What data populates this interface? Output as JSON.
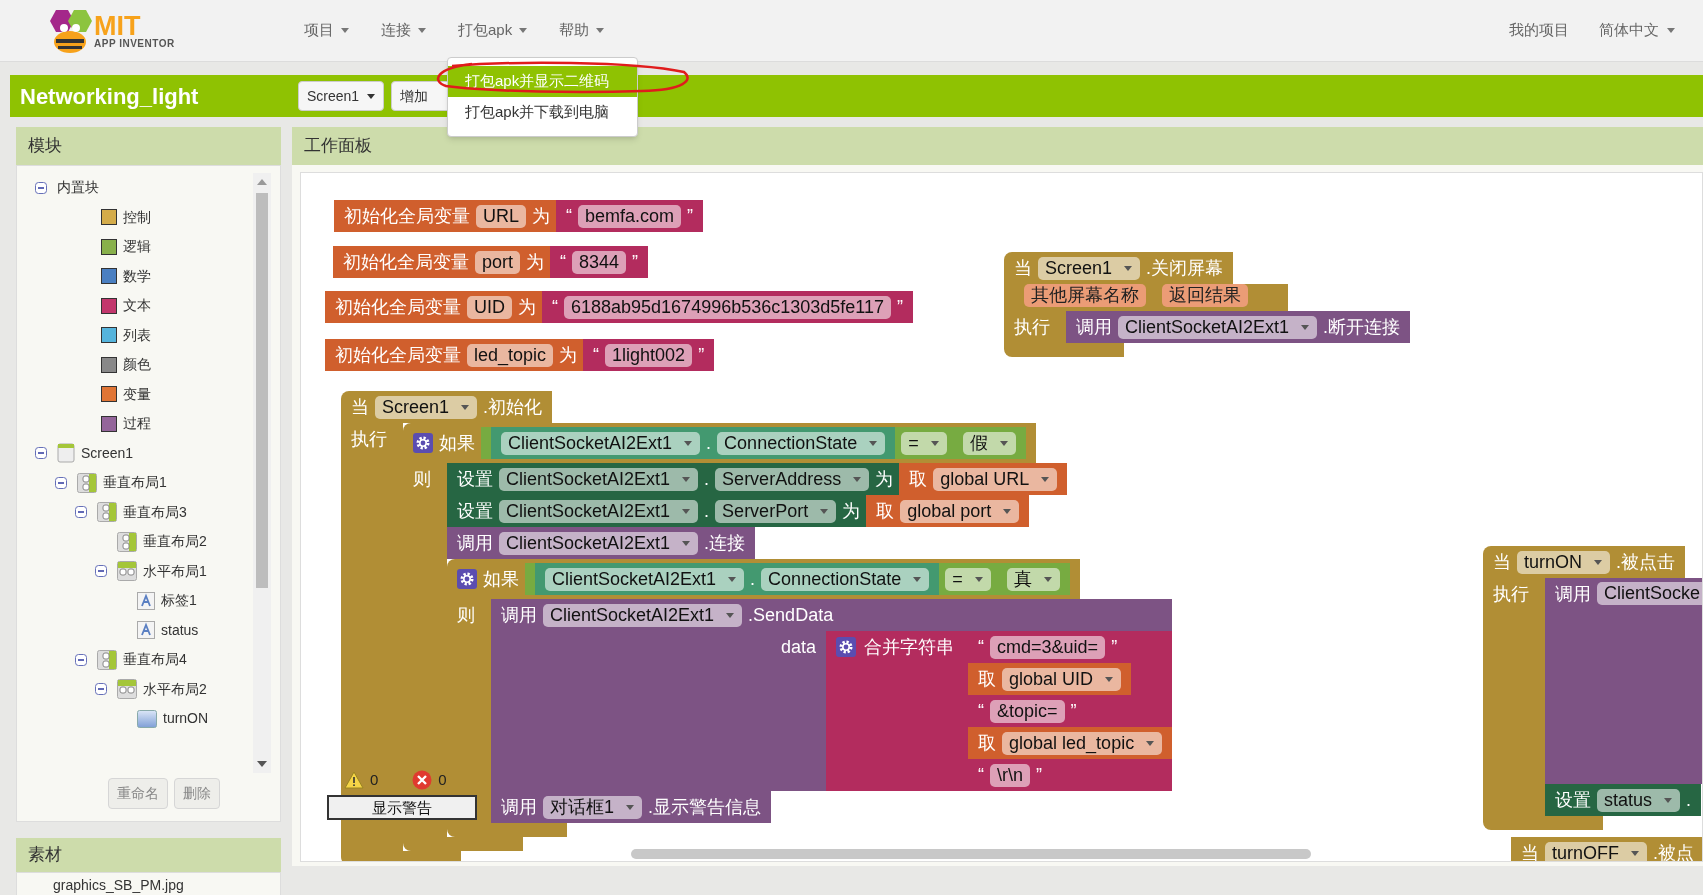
{
  "logo": {
    "title": "MIT",
    "subtitle": "APP INVENTOR"
  },
  "menus": [
    {
      "label": "项目"
    },
    {
      "label": "连接"
    },
    {
      "label": "打包apk"
    },
    {
      "label": "帮助"
    }
  ],
  "right_links": [
    {
      "label": "我的项目",
      "dropdown": false
    },
    {
      "label": "简体中文",
      "dropdown": true
    }
  ],
  "project_bar": {
    "title": "Networking_light",
    "screen_button": "Screen1",
    "add_screen_button": "增加"
  },
  "menu_popup": {
    "items": [
      {
        "label": "打包apk并显示二维码",
        "selected": true
      },
      {
        "label": "打包apk并下载到电脑",
        "selected": false
      }
    ]
  },
  "blocks_panel": {
    "title": "模块",
    "tree": [
      {
        "label": "内置块",
        "kind": "group",
        "expanded": true,
        "children": [
          {
            "label": "控制",
            "kind": "category",
            "color": "#d4ac4a"
          },
          {
            "label": "逻辑",
            "kind": "category",
            "color": "#88b04b"
          },
          {
            "label": "数学",
            "kind": "category",
            "color": "#4a7fc1"
          },
          {
            "label": "文本",
            "kind": "category",
            "color": "#c2376c"
          },
          {
            "label": "列表",
            "kind": "category",
            "color": "#55b4dc"
          },
          {
            "label": "颜色",
            "kind": "category",
            "color": "#888888"
          },
          {
            "label": "变量",
            "kind": "category",
            "color": "#e07535"
          },
          {
            "label": "过程",
            "kind": "category",
            "color": "#94659a"
          }
        ]
      },
      {
        "label": "Screen1",
        "kind": "screen",
        "expanded": true,
        "children": [
          {
            "label": "垂直布局1",
            "kind": "vertical",
            "expanded": true,
            "children": [
              {
                "label": "垂直布局3",
                "kind": "vertical",
                "expanded": true,
                "children": [
                  {
                    "label": "垂直布局2",
                    "kind": "vertical"
                  },
                  {
                    "label": "水平布局1",
                    "kind": "horizontal",
                    "expanded": true,
                    "children": [
                      {
                        "label": "标签1",
                        "kind": "label"
                      },
                      {
                        "label": "status",
                        "kind": "label"
                      }
                    ]
                  }
                ]
              },
              {
                "label": "垂直布局4",
                "kind": "vertical",
                "expanded": true,
                "children": [
                  {
                    "label": "水平布局2",
                    "kind": "horizontal",
                    "expanded": true,
                    "children": [
                      {
                        "label": "turnON",
                        "kind": "button"
                      }
                    ]
                  }
                ]
              }
            ]
          }
        ]
      }
    ],
    "buttons": [
      "重命名",
      "删除"
    ]
  },
  "media_panel": {
    "title": "素材",
    "items": [
      "graphics_SB_PM.jpg"
    ]
  },
  "workspace": {
    "title": "工作面板",
    "warnings": "0",
    "errors": "0",
    "show_warnings_button": "显示警告",
    "blocks": [
      {
        "kind": "variables",
        "parts": [
          {
            "kind": "text",
            "text": "初始化全局变量"
          },
          {
            "kind": "field",
            "text": "URL"
          },
          {
            "kind": "text",
            "text": "为"
          },
          {
            "kind": "block",
            "block": {
              "kind": "text",
              "parts": [
                {
                  "kind": "text",
                  "text": "“"
                },
                {
                  "kind": "field",
                  "text": "bemfa.com"
                },
                {
                  "kind": "text",
                  "text": "”"
                }
              ]
            }
          }
        ]
      },
      {
        "kind": "variables",
        "parts": [
          {
            "kind": "text",
            "text": "初始化全局变量"
          },
          {
            "kind": "field",
            "text": "port"
          },
          {
            "kind": "text",
            "text": "为"
          },
          {
            "kind": "block",
            "block": {
              "kind": "text",
              "parts": [
                {
                  "kind": "text",
                  "text": "“"
                },
                {
                  "kind": "field",
                  "text": "8344"
                },
                {
                  "kind": "text",
                  "text": "”"
                }
              ]
            }
          }
        ]
      },
      {
        "kind": "variables",
        "parts": [
          {
            "kind": "text",
            "text": "初始化全局变量"
          },
          {
            "kind": "field",
            "text": "UID"
          },
          {
            "kind": "text",
            "text": "为"
          },
          {
            "kind": "block",
            "block": {
              "kind": "text",
              "parts": [
                {
                  "kind": "text",
                  "text": "“"
                },
                {
                  "kind": "field",
                  "text": "6188ab95d1674996b536c1303d5fe117"
                },
                {
                  "kind": "text",
                  "text": "”"
                }
              ]
            }
          }
        ]
      },
      {
        "kind": "variables",
        "parts": [
          {
            "kind": "text",
            "text": "初始化全局变量"
          },
          {
            "kind": "field",
            "text": "led_topic"
          },
          {
            "kind": "text",
            "text": "为"
          },
          {
            "kind": "block",
            "block": {
              "kind": "text",
              "parts": [
                {
                  "kind": "text",
                  "text": "“"
                },
                {
                  "kind": "field",
                  "text": "1light002"
                },
                {
                  "kind": "text",
                  "text": "”"
                }
              ]
            }
          }
        ]
      },
      {
        "kind": "control",
        "parts": [
          {
            "kind": "text",
            "text": "当"
          },
          {
            "kind": "dropdown",
            "text": "Screen1"
          },
          {
            "kind": "text",
            "text": ".初始化"
          }
        ],
        "sections": [
          {
            "label": "执行",
            "statements": [
              {
                "kind": "control",
                "parts": [
                  {
                    "kind": "gear"
                  },
                  {
                    "kind": "text",
                    "text": "如果"
                  },
                  {
                    "kind": "block",
                    "block": {
                      "kind": "logic",
                      "parts": [
                        {
                          "kind": "block",
                          "block": {
                            "kind": "component",
                            "parts": [
                              {
                                "kind": "dropdown",
                                "text": "ClientSocketAI2Ext1"
                              },
                              {
                                "kind": "text",
                                "text": "."
                              },
                              {
                                "kind": "dropdown",
                                "text": "ConnectionState"
                              }
                            ]
                          }
                        },
                        {
                          "kind": "dropdown",
                          "text": "="
                        },
                        {
                          "kind": "block",
                          "block": {
                            "kind": "logic",
                            "parts": [
                              {
                                "kind": "dropdown",
                                "text": "假"
                              }
                            ]
                          }
                        }
                      ]
                    }
                  }
                ],
                "sections": [
                  {
                    "label": "则",
                    "statements": [
                      {
                        "kind": "setter",
                        "parts": [
                          {
                            "kind": "text",
                            "text": "设置"
                          },
                          {
                            "kind": "dropdown",
                            "text": "ClientSocketAI2Ext1"
                          },
                          {
                            "kind": "text",
                            "text": "."
                          },
                          {
                            "kind": "dropdown",
                            "text": "ServerAddress"
                          },
                          {
                            "kind": "text",
                            "text": "为"
                          },
                          {
                            "kind": "block",
                            "block": {
                              "kind": "variables",
                              "parts": [
                                {
                                  "kind": "text",
                                  "text": "取"
                                },
                                {
                                  "kind": "dropdown",
                                  "text": "global URL"
                                }
                              ]
                            }
                          }
                        ]
                      },
                      {
                        "kind": "setter",
                        "parts": [
                          {
                            "kind": "text",
                            "text": "设置"
                          },
                          {
                            "kind": "dropdown",
                            "text": "ClientSocketAI2Ext1"
                          },
                          {
                            "kind": "text",
                            "text": "."
                          },
                          {
                            "kind": "dropdown",
                            "text": "ServerPort"
                          },
                          {
                            "kind": "text",
                            "text": "为"
                          },
                          {
                            "kind": "block",
                            "block": {
                              "kind": "variables",
                              "parts": [
                                {
                                  "kind": "text",
                                  "text": "取"
                                },
                                {
                                  "kind": "dropdown",
                                  "text": "global port"
                                }
                              ]
                            }
                          }
                        ]
                      },
                      {
                        "kind": "method",
                        "parts": [
                          {
                            "kind": "text",
                            "text": "调用"
                          },
                          {
                            "kind": "dropdown",
                            "text": "ClientSocketAI2Ext1"
                          },
                          {
                            "kind": "text",
                            "text": ".连接"
                          }
                        ]
                      },
                      {
                        "kind": "control",
                        "parts": [
                          {
                            "kind": "gear"
                          },
                          {
                            "kind": "text",
                            "text": "如果"
                          },
                          {
                            "kind": "block",
                            "block": {
                              "kind": "logic",
                              "parts": [
                                {
                                  "kind": "block",
                                  "block": {
                                    "kind": "component",
                                    "parts": [
                                      {
                                        "kind": "dropdown",
                                        "text": "ClientSocketAI2Ext1"
                                      },
                                      {
                                        "kind": "text",
                                        "text": "."
                                      },
                                      {
                                        "kind": "dropdown",
                                        "text": "ConnectionState"
                                      }
                                    ]
                                  }
                                },
                                {
                                  "kind": "dropdown",
                                  "text": "="
                                },
                                {
                                  "kind": "block",
                                  "block": {
                                    "kind": "logic",
                                    "parts": [
                                      {
                                        "kind": "dropdown",
                                        "text": "真"
                                      }
                                    ]
                                  }
                                }
                              ]
                            }
                          }
                        ],
                        "sections": [
                          {
                            "label": "则",
                            "statements": [
                              {
                                "kind": "method",
                                "parts": [
                                  {
                                    "kind": "text",
                                    "text": "调用"
                                  },
                                  {
                                    "kind": "dropdown",
                                    "text": "ClientSocketAI2Ext1"
                                  },
                                  {
                                    "kind": "text",
                                    "text": ".SendData"
                                  }
                                ],
                                "args": [
                                  {
                                    "label": "data",
                                    "block": {
                                      "kind": "text",
                                      "parts": [
                                        {
                                          "kind": "gear"
                                        },
                                        {
                                          "kind": "text",
                                          "text": "合并字符串"
                                        }
                                      ],
                                      "inputs": [
                                        {
                                          "kind": "text",
                                          "parts": [
                                            {
                                              "kind": "text",
                                              "text": "“"
                                            },
                                            {
                                              "kind": "field",
                                              "text": "cmd=3&uid="
                                            },
                                            {
                                              "kind": "text",
                                              "text": "”"
                                            }
                                          ]
                                        },
                                        {
                                          "kind": "variables",
                                          "parts": [
                                            {
                                              "kind": "text",
                                              "text": "取"
                                            },
                                            {
                                              "kind": "dropdown",
                                              "text": "global UID"
                                            }
                                          ]
                                        },
                                        {
                                          "kind": "text",
                                          "parts": [
                                            {
                                              "kind": "text",
                                              "text": "“"
                                            },
                                            {
                                              "kind": "field",
                                              "text": "&topic="
                                            },
                                            {
                                              "kind": "text",
                                              "text": "”"
                                            }
                                          ]
                                        },
                                        {
                                          "kind": "variables",
                                          "parts": [
                                            {
                                              "kind": "text",
                                              "text": "取"
                                            },
                                            {
                                              "kind": "dropdown",
                                              "text": "global led_topic"
                                            }
                                          ]
                                        },
                                        {
                                          "kind": "text",
                                          "parts": [
                                            {
                                              "kind": "text",
                                              "text": "“"
                                            },
                                            {
                                              "kind": "field",
                                              "text": "\\r\\n"
                                            },
                                            {
                                              "kind": "text",
                                              "text": "”"
                                            }
                                          ]
                                        }
                                      ]
                                    }
                                  }
                                ]
                              },
                              {
                                "kind": "method",
                                "parts": [
                                  {
                                    "kind": "text",
                                    "text": "调用"
                                  },
                                  {
                                    "kind": "dropdown",
                                    "text": "对话框1"
                                  },
                                  {
                                    "kind": "text",
                                    "text": ".显示警告信息"
                                  }
                                ]
                              }
                            ]
                          }
                        ]
                      }
                    ]
                  }
                ]
              }
            ]
          }
        ]
      },
      {
        "kind": "control",
        "parts": [
          {
            "kind": "text",
            "text": "当"
          },
          {
            "kind": "dropdown",
            "text": "Screen1"
          },
          {
            "kind": "text",
            "text": ".关闭屏幕"
          }
        ],
        "params": [
          "其他屏幕名称",
          "返回结果"
        ],
        "sections": [
          {
            "label": "执行",
            "statements": [
              {
                "kind": "method",
                "parts": [
                  {
                    "kind": "text",
                    "text": "调用"
                  },
                  {
                    "kind": "dropdown",
                    "text": "ClientSocketAI2Ext1"
                  },
                  {
                    "kind": "text",
                    "text": ".断开连接"
                  }
                ]
              }
            ]
          }
        ]
      },
      {
        "kind": "control",
        "parts": [
          {
            "kind": "text",
            "text": "当"
          },
          {
            "kind": "dropdown",
            "text": "turnON"
          },
          {
            "kind": "text",
            "text": ".被点击"
          }
        ],
        "sections": [
          {
            "label": "执行",
            "statements": [
              {
                "kind": "method",
                "parts": [
                  {
                    "kind": "text",
                    "text": "调用"
                  },
                  {
                    "kind": "field",
                    "text": "ClientSocke"
                  }
                ]
              },
              {
                "kind": "setter",
                "parts": [
                  {
                    "kind": "text",
                    "text": "设置"
                  },
                  {
                    "kind": "dropdown",
                    "text": "status"
                  },
                  {
                    "kind": "text",
                    "text": "."
                  }
                ]
              }
            ]
          }
        ]
      },
      {
        "kind": "control",
        "parts": [
          {
            "kind": "text",
            "text": "当"
          },
          {
            "kind": "dropdown",
            "text": "turnOFF"
          },
          {
            "kind": "text",
            "text": ".被点"
          }
        ]
      }
    ]
  }
}
